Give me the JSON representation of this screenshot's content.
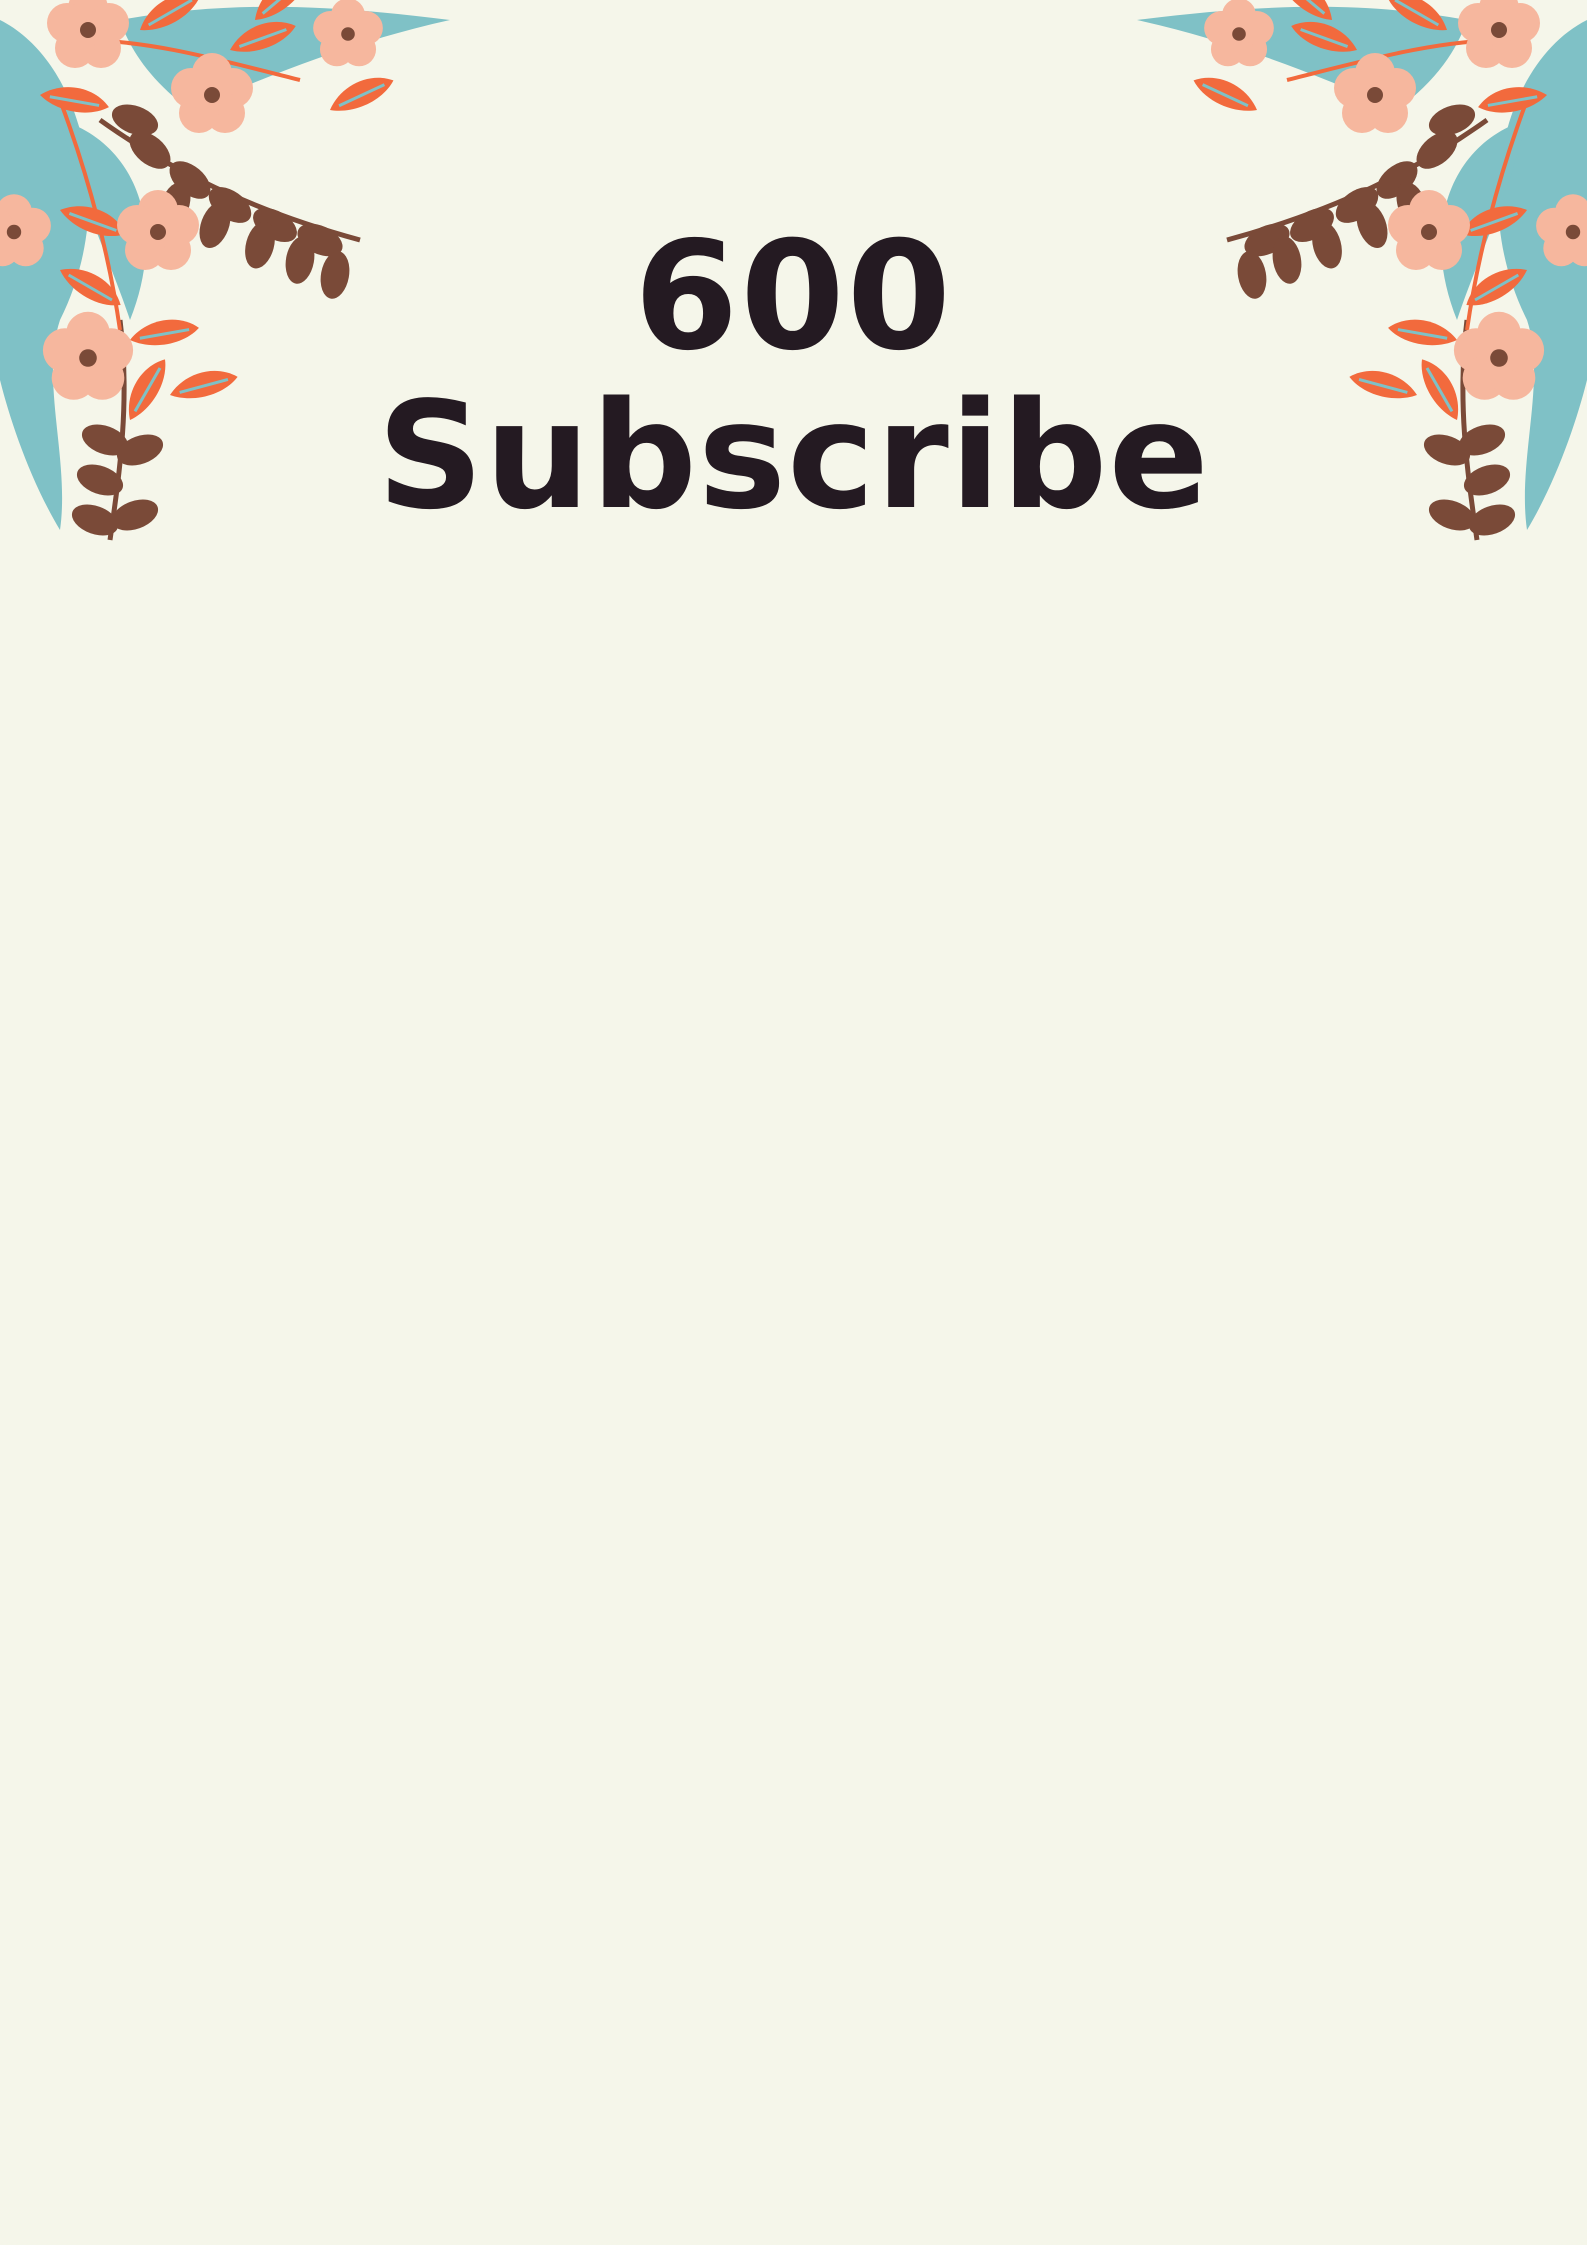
{
  "headline": {
    "count": "600",
    "label": "Subscribe"
  },
  "decoration": {
    "left": "floral-corner-left",
    "right": "floral-corner-right"
  },
  "colors": {
    "background": "#f5f6ea",
    "text": "#241a22",
    "leaf_teal": "#7fc1c6",
    "leaf_orange": "#f26a3d",
    "leaf_brown": "#7a4a38",
    "flower_peach": "#f6b79e"
  }
}
